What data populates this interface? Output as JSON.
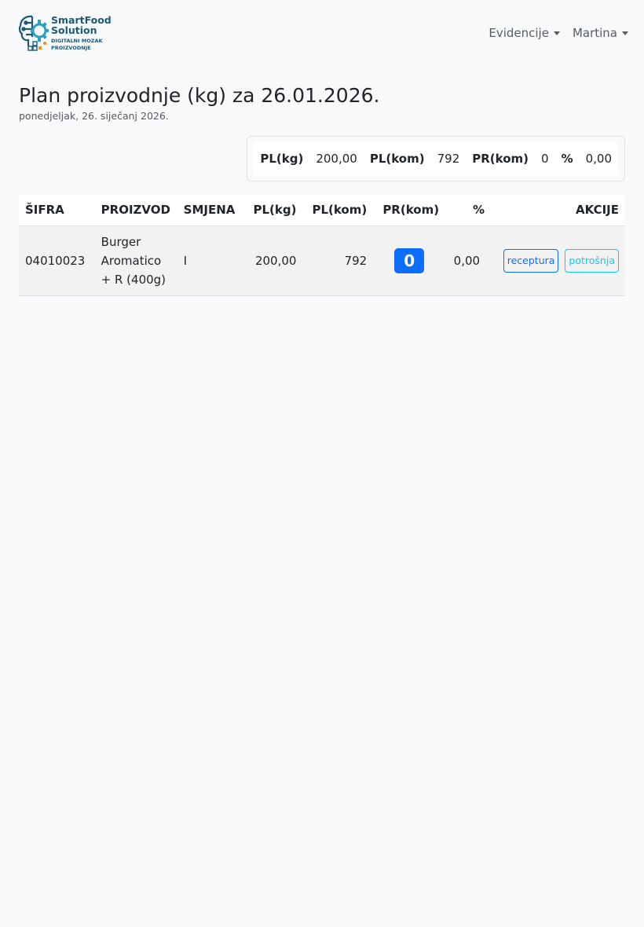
{
  "brand": {
    "name_line1": "SmartFood",
    "name_line2": "Solution",
    "tag_line1": "DIGITALNI MOZAK",
    "tag_line2": "PROIZVODNJE"
  },
  "nav": {
    "evidencije": "Evidencije",
    "user": "Martina"
  },
  "page": {
    "title": "Plan proizvodnje (kg) za 26.01.2026.",
    "subtitle": "ponedjeljak, 26. siječanj 2026."
  },
  "summary": {
    "pl_kg_label": "PL(kg)",
    "pl_kg_value": "200,00",
    "pl_kom_label": "PL(kom)",
    "pl_kom_value": "792",
    "pr_kom_label": "PR(kom)",
    "pr_kom_value": "0",
    "pct_label": "%",
    "pct_value": "0,00"
  },
  "table": {
    "headers": [
      "ŠIFRA",
      "PROIZVOD",
      "SMJENA",
      "PL(kg)",
      "PL(kom)",
      "PR(kom)",
      "%",
      "AKCIJE"
    ],
    "rows": [
      {
        "sifra": "04010023",
        "proizvod": "Burger Aromatico + R (400g)",
        "smjena": "I",
        "pl_kg": "200,00",
        "pl_kom": "792",
        "pr_kom": "0",
        "pct": "0,00",
        "btn_receptura": "receptura",
        "btn_potrosnja": "potrošnja"
      }
    ]
  },
  "colors": {
    "primary": "#0d6efd",
    "info": "#0dcaf0",
    "brand": "#1d5a78",
    "accent_orange": "#f39200"
  }
}
